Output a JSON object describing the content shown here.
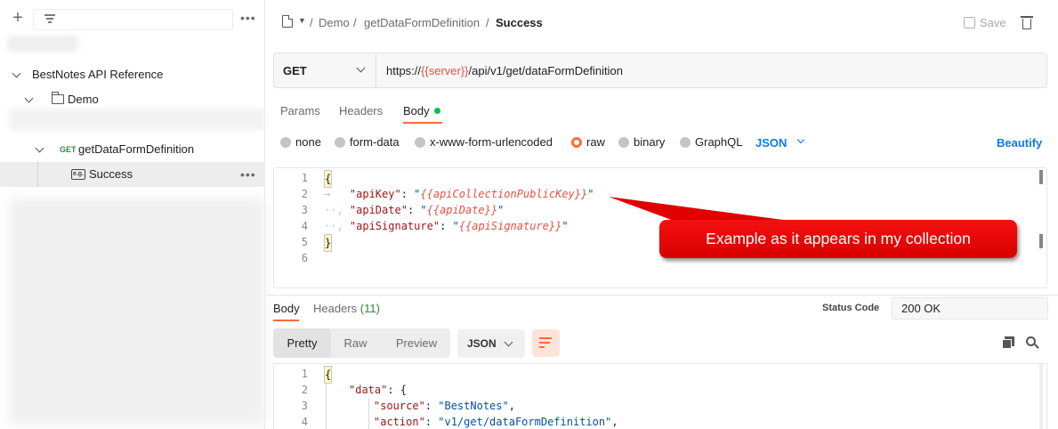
{
  "sidebar": {
    "add_label": "+",
    "more_label": "•••",
    "collection": "BestNotes API Reference",
    "folder": "Demo",
    "request_method": "GET",
    "request_name": "getDataFormDefinition",
    "example_icon": "e.g.",
    "example_name": "Success",
    "example_more": "•••"
  },
  "header": {
    "crumbs": [
      "Demo",
      "getDataFormDefinition",
      "Success"
    ],
    "sep": "/",
    "save_label": "Save"
  },
  "request": {
    "method": "GET",
    "url_prefix": "https://",
    "url_var": "{{server}}",
    "url_suffix": "/api/v1/get/dataFormDefinition"
  },
  "request_tabs": [
    "Params",
    "Headers",
    "Body"
  ],
  "body_types": [
    "none",
    "form-data",
    "x-www-form-urlencoded",
    "raw",
    "binary",
    "GraphQL"
  ],
  "body_type_selected": "raw",
  "body_format": "JSON",
  "beautify_label": "Beautify",
  "request_code": {
    "line_numbers": [
      "1",
      "2",
      "3",
      "4",
      "5",
      "6"
    ],
    "line1": "{",
    "line2_ws": "→   ",
    "line2_key": "\"apiKey\"",
    "line2_colon": ": ",
    "line2_val": "{{apiCollectionPublicKey}}",
    "line3_ws": "··, ",
    "line3_key": "\"apiDate\"",
    "line3_colon": ": ",
    "line3_val": "{{apiDate}}",
    "line4_ws": "··, ",
    "line4_key": "\"apiSignature\"",
    "line4_colon": ": ",
    "line4_val": "{{apiSignature}}",
    "line5": "}"
  },
  "callout_text": "Example as it appears in my collection",
  "response": {
    "tab_body": "Body",
    "tab_headers": "Headers",
    "headers_count": "(11)",
    "status_label": "Status Code",
    "status_value": "200 OK",
    "views": [
      "Pretty",
      "Raw",
      "Preview"
    ],
    "format": "JSON",
    "line_numbers": [
      "1",
      "2",
      "3",
      "4"
    ],
    "line1": "{",
    "line2_key": "\"data\"",
    "line2_rest": ": {",
    "line3_key": "\"source\"",
    "line3_colon": ": ",
    "line3_val": "\"BestNotes\"",
    "line3_end": ",",
    "line4_key": "\"action\"",
    "line4_colon": ": ",
    "line4_val": "\"v1/get/dataFormDefinition\"",
    "line4_end": ","
  },
  "colors": {
    "accent": "#ff6c37",
    "link": "#097bed",
    "variable": "#e05243",
    "callout": "#e50000"
  },
  "icons": [
    "plus-icon",
    "filter-icon",
    "more-icon",
    "chevron-down-icon",
    "folder-icon",
    "example-icon",
    "page-icon",
    "save-icon",
    "trash-icon",
    "wrap-icon",
    "copy-icon",
    "search-icon"
  ]
}
